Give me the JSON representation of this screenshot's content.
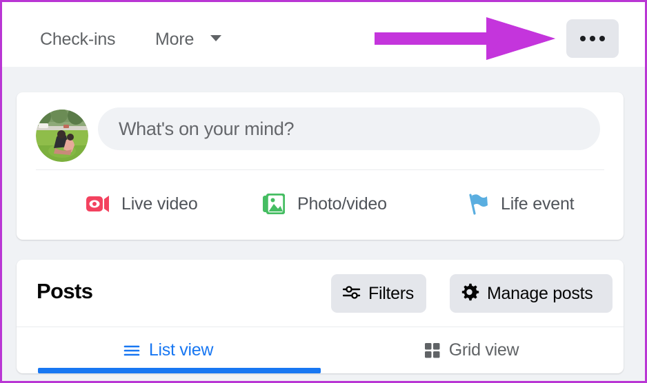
{
  "accent": {
    "annotation_arrow": "#c435dc",
    "page_border": "#b936d4",
    "active_tab_blue": "#1877f2",
    "page_background": "#f0f2f5",
    "card_background": "#ffffff",
    "button_background": "#e4e6eb"
  },
  "topnav": {
    "links": [
      {
        "label": "Check-ins",
        "icon": ""
      },
      {
        "label": "More",
        "icon": "chevron-down-icon"
      }
    ],
    "more_menu_button": {
      "label": "",
      "icon": "three-dots-icon"
    }
  },
  "composer": {
    "avatar_alt": "profile-photo",
    "placeholder": "What's on your mind?",
    "actions": [
      {
        "label": "Live video",
        "icon": "live-video-icon",
        "color": "#f3425f"
      },
      {
        "label": "Photo/video",
        "icon": "photo-video-icon",
        "color": "#45bd62"
      },
      {
        "label": "Life event",
        "icon": "life-event-flag-icon",
        "color": "#5aaee0"
      }
    ]
  },
  "posts": {
    "title": "Posts",
    "filters_button": {
      "label": "Filters",
      "icon": "sliders-icon"
    },
    "manage_posts_button": {
      "label": "Manage posts",
      "icon": "gear-icon"
    },
    "tabs": [
      {
        "label": "List view",
        "icon": "list-icon",
        "active": true
      },
      {
        "label": "Grid view",
        "icon": "grid-icon",
        "active": false
      }
    ]
  }
}
